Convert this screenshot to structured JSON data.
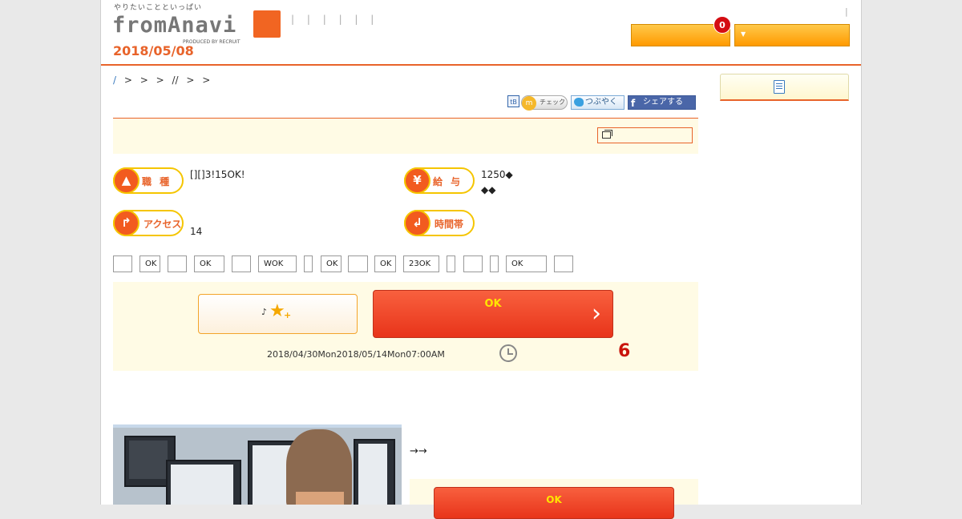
{
  "header": {
    "logo_tagline": "やりたいことといっぱい",
    "logo_text": "fromAnavi",
    "logo_produced": "PRODUCED BY RECRUIT",
    "date": "2018/05/08",
    "nav_separators": "| | | | | |",
    "top_right_separator": "|",
    "badge_count": "0",
    "dropdown_arrow": "▼"
  },
  "breadcrumb": {
    "first": "/",
    "rest": "> > > //   > >"
  },
  "social": {
    "hatena": "tB",
    "check": "チェック",
    "tweet": "つぶやく",
    "facebook": "シェアする"
  },
  "job": {
    "type_label": "職 種",
    "type_value": "[][]3!15OK!",
    "salary_label": "給 与",
    "salary_line1": "1250◆",
    "salary_line2": "◆◆",
    "access_label": "アクセス",
    "access_value": "14",
    "time_label": "時間帯"
  },
  "tags": [
    "",
    "OK",
    "",
    "OK",
    "",
    "WOK",
    "",
    "OK",
    "",
    "OK",
    "23OK",
    "",
    "",
    "",
    "OK",
    ""
  ],
  "apply": {
    "favorite_note": "♪",
    "favorite_icon": "★",
    "favorite_plus": "+",
    "apply_label": "OK",
    "chevron": "›",
    "period": "2018/04/30Mon2018/05/14Mon07:00AM",
    "days_left": "6"
  },
  "lower": {
    "arrows": "→→",
    "apply_label": "OK"
  },
  "colors": {
    "accent": "#e8632a",
    "apply_red": "#e8341a",
    "cream": "#fffbe5",
    "days_red": "#c9150d"
  },
  "icons": [
    "search-icon",
    "document-icon",
    "clock-icon",
    "star-icon",
    "chevron-right-icon",
    "yen-icon",
    "shirt-icon",
    "route-icon"
  ]
}
